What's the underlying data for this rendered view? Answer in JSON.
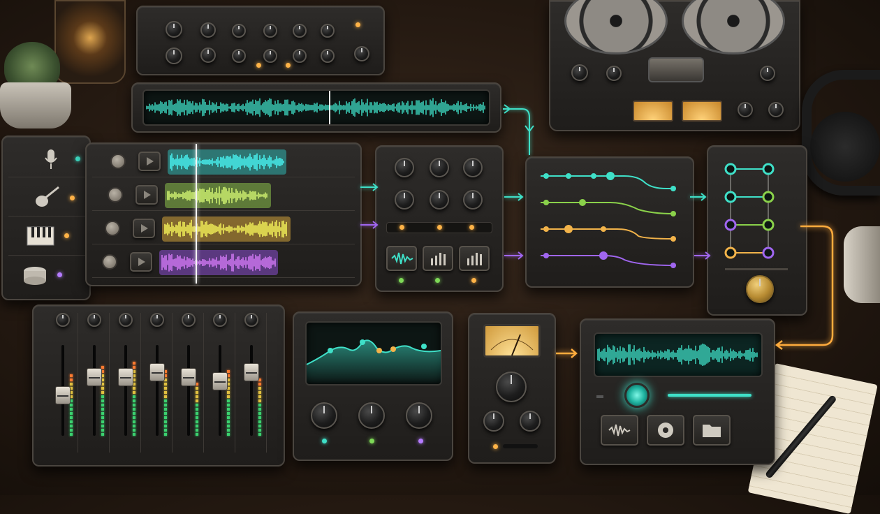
{
  "colors": {
    "teal": "#3fe0c8",
    "green": "#8ad14a",
    "orange": "#f2b34a",
    "purple": "#a066f0",
    "cable_orange": "#ffab3d"
  },
  "track_panel": {
    "tracks": [
      {
        "name": "track-1",
        "color": "#2fb5b0",
        "level": 0.74
      },
      {
        "name": "track-2",
        "color": "#8ac04a",
        "level": 0.66
      },
      {
        "name": "track-3",
        "color": "#d2a23a",
        "level": 0.8
      },
      {
        "name": "track-4",
        "color": "#8a4fd0",
        "level": 0.74
      }
    ]
  },
  "instrument_column": {
    "items": [
      {
        "icon": "microphone-icon",
        "led": "teal"
      },
      {
        "icon": "guitar-icon",
        "led": "orange"
      },
      {
        "icon": "piano-icon",
        "led": "orange"
      },
      {
        "icon": "drum-icon",
        "led": "purple"
      }
    ]
  },
  "fx_panel": {
    "buttons": [
      {
        "icon": "waveform-icon",
        "led": "green"
      },
      {
        "icon": "bars-icon",
        "led": "green"
      },
      {
        "icon": "level-bars-icon",
        "led": "orange"
      }
    ]
  },
  "mixer": {
    "channels": [
      {
        "fader": 0.55,
        "meter": 0.7
      },
      {
        "fader": 0.35,
        "meter": 0.8
      },
      {
        "fader": 0.35,
        "meter": 0.85
      },
      {
        "fader": 0.3,
        "meter": 0.75
      },
      {
        "fader": 0.35,
        "meter": 0.6
      },
      {
        "fader": 0.4,
        "meter": 0.72
      },
      {
        "fader": 0.3,
        "meter": 0.65
      }
    ]
  },
  "transport": {
    "buttons": [
      "waveform-icon",
      "record-disc-icon",
      "folder-icon"
    ]
  }
}
